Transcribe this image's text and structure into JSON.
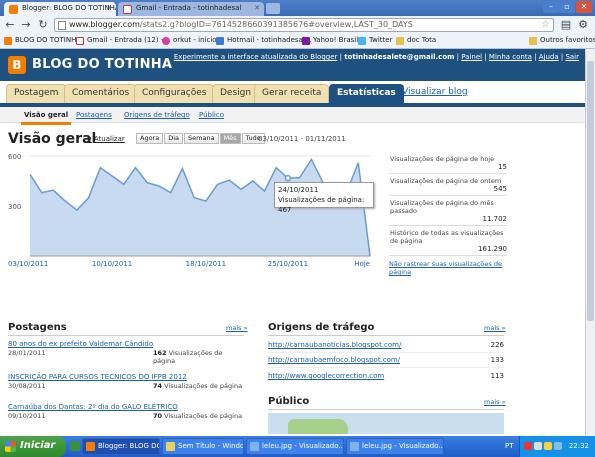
{
  "browser": {
    "tabs": [
      {
        "title": "Blogger: BLOG DO TOTINHA",
        "active": true
      },
      {
        "title": "Gmail - Entrada - totinhadesal",
        "active": false
      }
    ],
    "url_host": "www.blogger.com",
    "url_rest": "/stats2.g?blogID=7614528660391385676#overview,LAST_30_DAYS",
    "bookmarks": [
      "BLOG DO TOTINHA",
      "Gmail - Entrada (12) -...",
      "orkut - início",
      "Hotmail - totinhadesal...",
      "Yahoo! Brasil",
      "Twitter",
      "doc Tota",
      "Outros favoritos"
    ]
  },
  "blogger": {
    "title": "BLOG DO TOTINHA",
    "top_links": {
      "experience": "Experimente a interface atualizada do Blogger",
      "email": "totinhadesalete@gmail.com",
      "links": [
        "Painel",
        "Minha conta",
        "Ajuda",
        "Sair"
      ]
    },
    "tabs": [
      "Postagem",
      "Comentários",
      "Configurações",
      "Design",
      "Gerar receita",
      "Estatísticas"
    ],
    "view_blog": "Visualizar blog",
    "subtabs": [
      "Visão geral",
      "Postagens",
      "Origens de tráfego",
      "Público"
    ]
  },
  "overview": {
    "title": "Visão geral",
    "refresh": "Atualizar",
    "ranges": [
      "Agora",
      "Dia",
      "Semana",
      "Mês",
      "Tudo"
    ],
    "selected_range": "Mês",
    "date_range": "03/10/2011 - 01/11/2011",
    "tooltip_date": "24/10/2011",
    "tooltip_label": "Visualizações de página: 467"
  },
  "chart_data": {
    "type": "area",
    "ylim": [
      0,
      600
    ],
    "y_ticks": [
      "600",
      "300"
    ],
    "x_tick_labels": [
      "03/10/2011",
      "10/10/2011",
      "18/10/2011",
      "25/10/2011",
      "Hoje"
    ],
    "x_tick_index": [
      0,
      7,
      15,
      22,
      29
    ],
    "values": [
      490,
      380,
      395,
      330,
      275,
      350,
      530,
      480,
      430,
      530,
      440,
      420,
      380,
      525,
      350,
      330,
      430,
      455,
      400,
      450,
      390,
      530,
      467,
      470,
      580,
      440,
      420,
      380,
      560,
      0
    ],
    "highlight_index": 22,
    "color": "#6b9bd2"
  },
  "stats": [
    {
      "label": "Visualizações de página de hoje",
      "value": "15"
    },
    {
      "label": "Visualizações de página de ontem",
      "value": "545"
    },
    {
      "label": "Visualizações de página do mês passado",
      "value": "11.702"
    },
    {
      "label": "Histórico de todas as visualizações de página",
      "value": "161.290"
    }
  ],
  "no_track": "Não rastrear suas visualizações de página",
  "posts": {
    "title": "Postagens",
    "more": "mais »",
    "items": [
      {
        "title": "80 anos do ex prefeito Valdemar Cândido",
        "date": "28/01/2011",
        "count": "162",
        "suffix": "Visualizações de página"
      },
      {
        "title": "INSCRIÇÃO PARA CURSOS TÉCNICOS DO IFPB 2012",
        "date": "30/08/2011",
        "count": "74",
        "suffix": "Visualizações de página"
      },
      {
        "title": "Carnaúba dos Dantas: 2º dia do GALO ELÉTRICO",
        "date": "09/10/2011",
        "count": "70",
        "suffix": "Visualizações de página"
      }
    ]
  },
  "traffic": {
    "title": "Origens de tráfego",
    "more": "mais »",
    "items": [
      {
        "url": "http://carnaubanoticias.blogspot.com/",
        "count": "226"
      },
      {
        "url": "http://carnaubaemfoco.blogspot.com/",
        "count": "133"
      },
      {
        "url": "http://www.googlecorrection.com",
        "count": "113"
      }
    ]
  },
  "audience": {
    "title": "Público",
    "more": "mais »"
  },
  "taskbar": {
    "start": "Iniciar",
    "tasks": [
      "Blogger: BLOG DO TO...",
      "Sem Título - Windows...",
      "leleu.jpg - Visualizado...",
      "leleu.jpg - Visualizado..."
    ],
    "lang": "PT",
    "clock": "22:32"
  }
}
